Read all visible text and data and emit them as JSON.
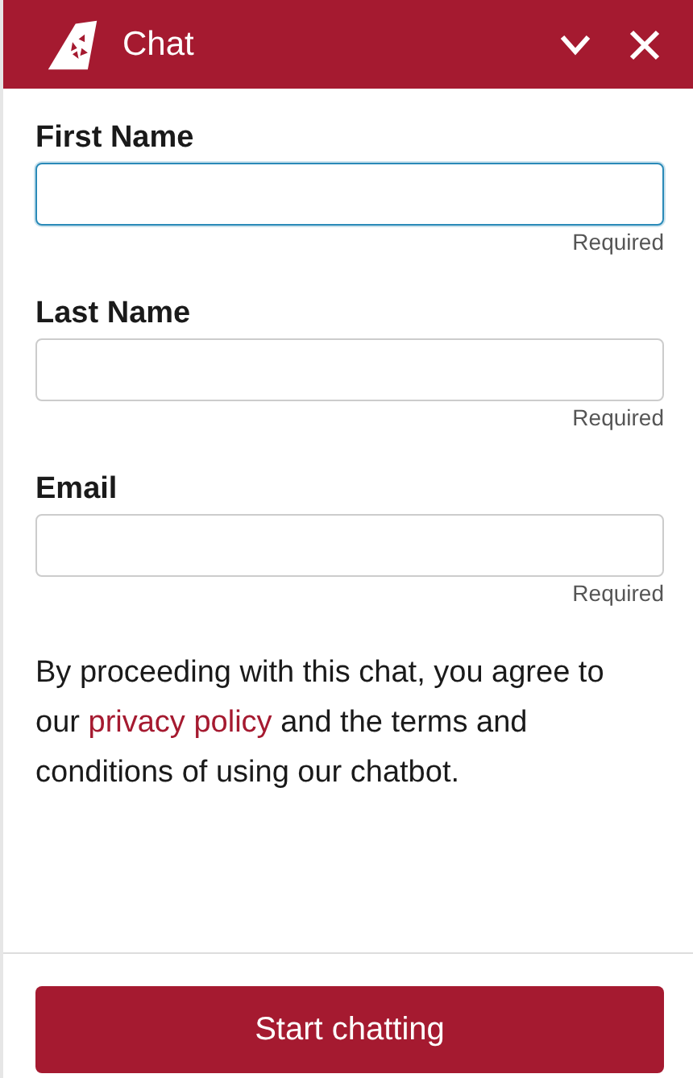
{
  "header": {
    "title": "Chat"
  },
  "fields": [
    {
      "label": "First Name",
      "hint": "Required",
      "focused": true
    },
    {
      "label": "Last Name",
      "hint": "Required",
      "focused": false
    },
    {
      "label": "Email",
      "hint": "Required",
      "focused": false
    }
  ],
  "consent": {
    "before": "By proceeding with this chat, you agree to our ",
    "link": "privacy policy",
    "after": " and the terms and conditions of using our chatbot."
  },
  "button": "Start chatting"
}
